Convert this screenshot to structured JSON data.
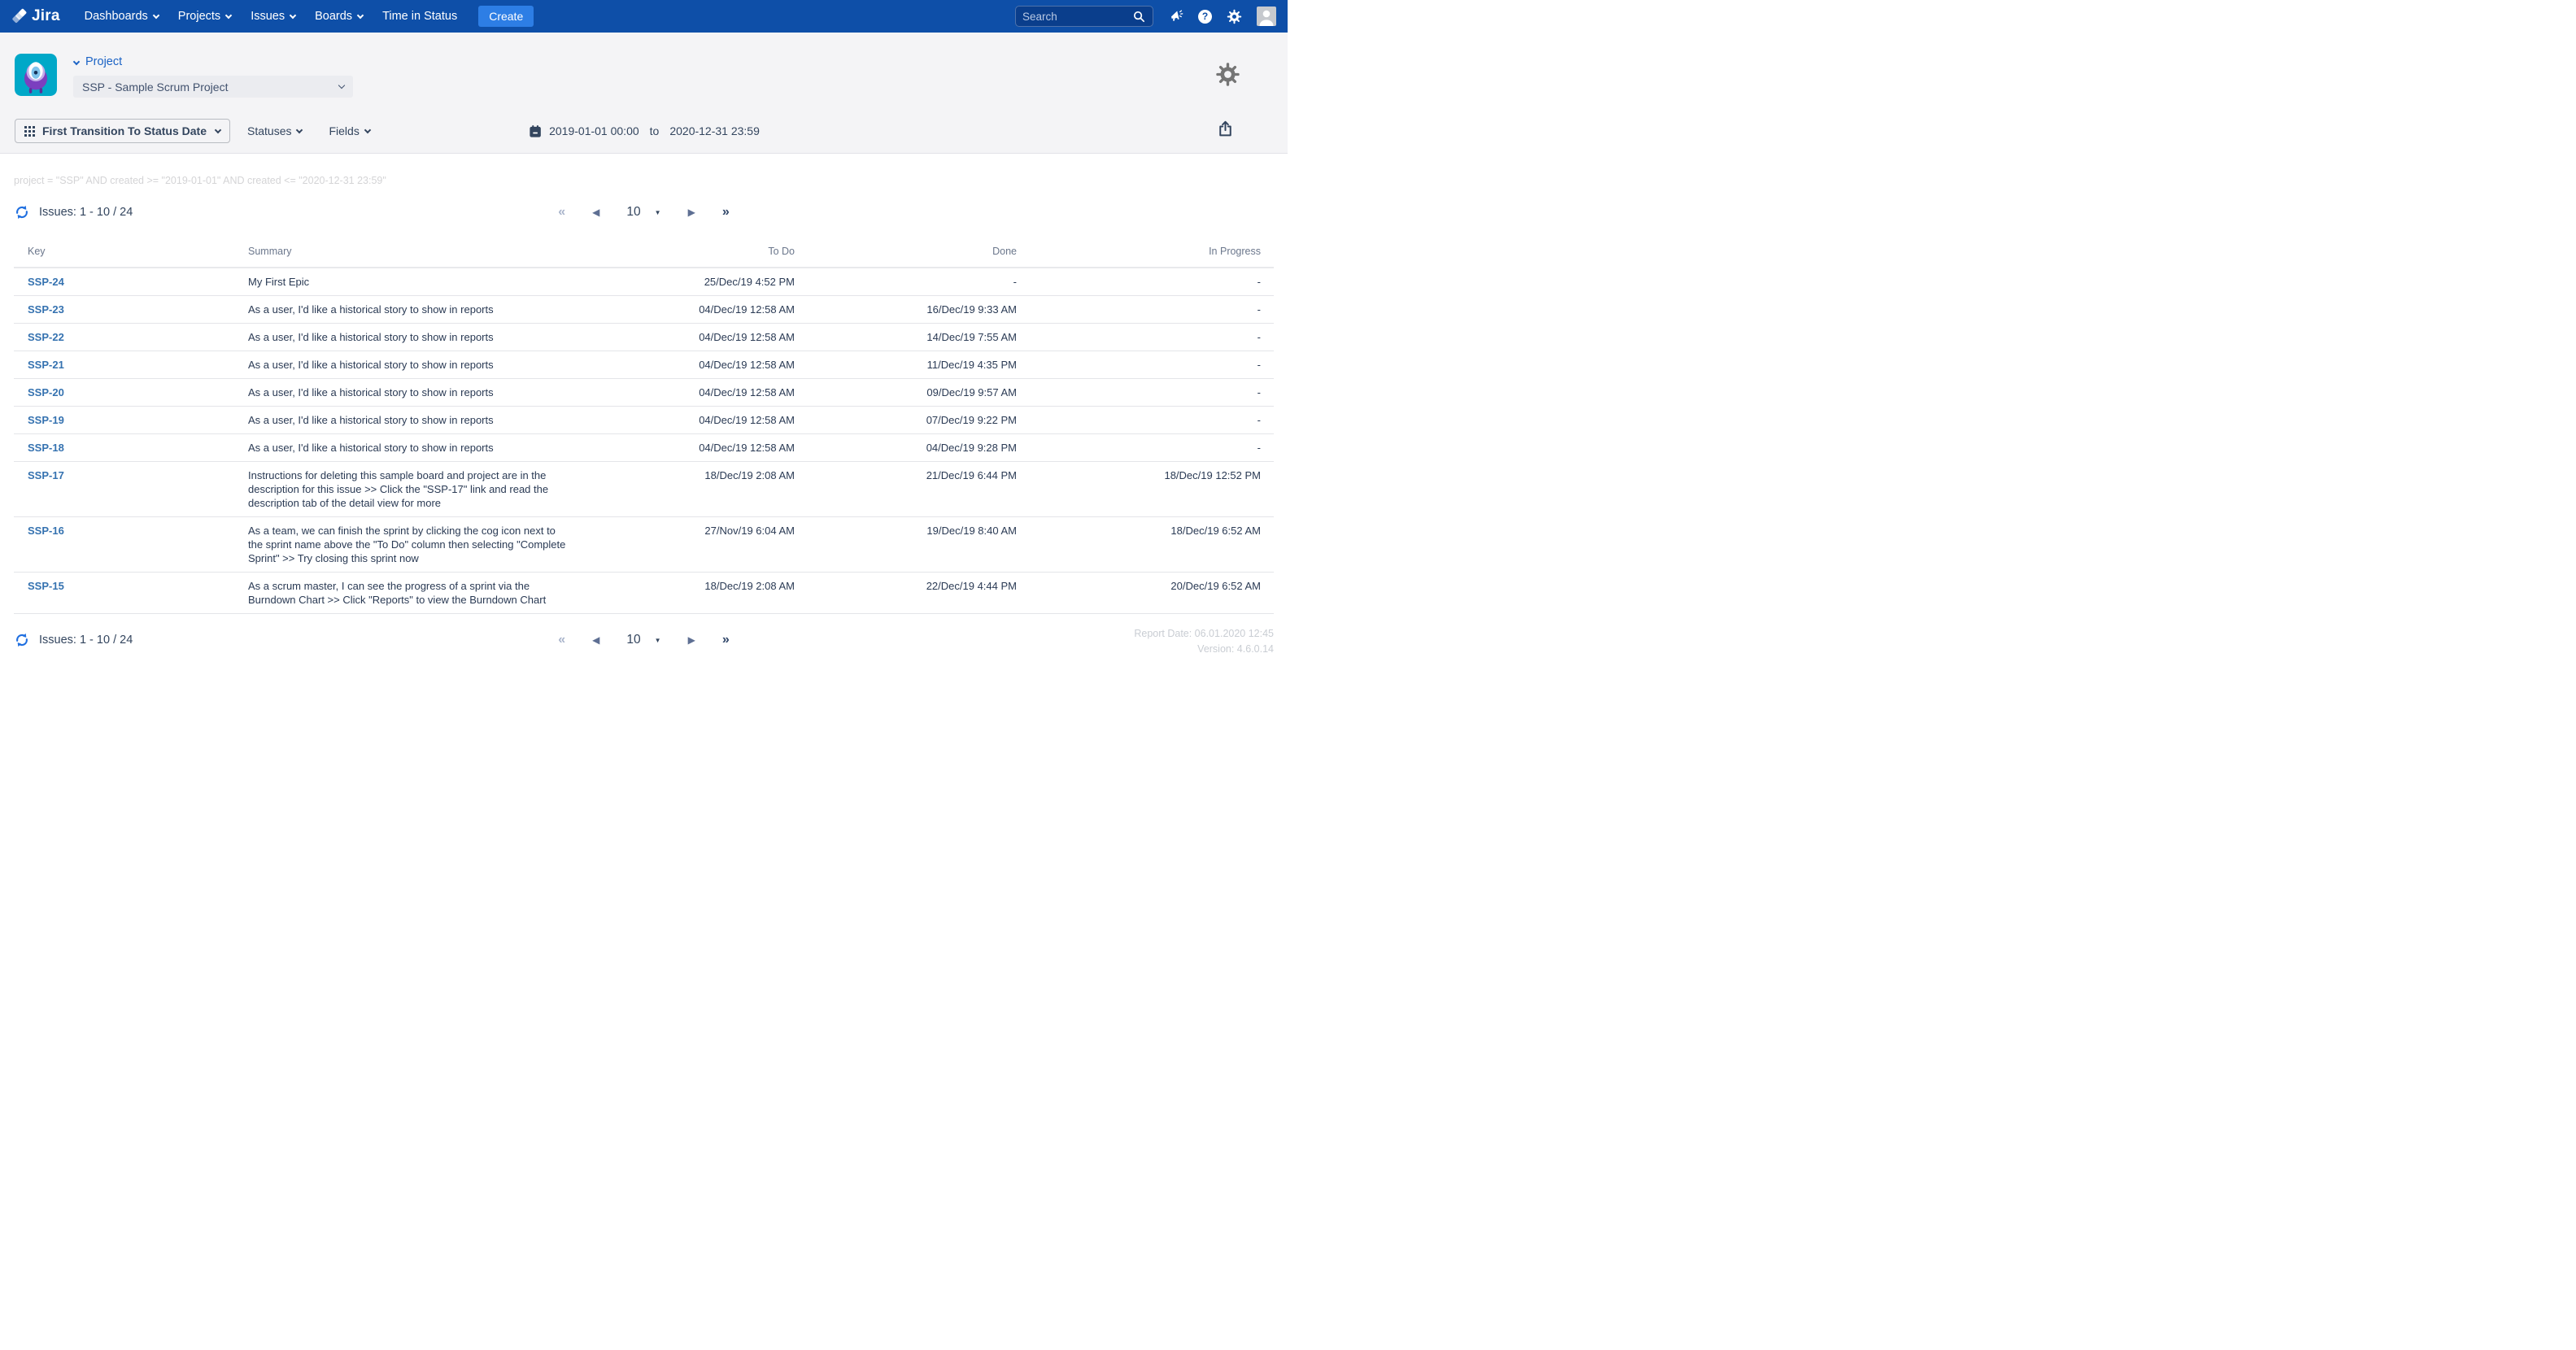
{
  "nav": {
    "brand": "Jira",
    "items": [
      {
        "label": "Dashboards"
      },
      {
        "label": "Projects"
      },
      {
        "label": "Issues"
      },
      {
        "label": "Boards"
      },
      {
        "label": "Time in Status"
      }
    ],
    "create_label": "Create",
    "search_placeholder": "Search"
  },
  "header": {
    "project_label": "Project",
    "project_select_value": "SSP - Sample Scrum Project"
  },
  "filters": {
    "report_type": "First Transition To Status Date",
    "statuses_label": "Statuses",
    "fields_label": "Fields",
    "date_from": "2019-01-01 00:00",
    "date_separator": "to",
    "date_to": "2020-12-31 23:59"
  },
  "jql": "project = \"SSP\" AND created >= \"2019-01-01\" AND created <= \"2020-12-31 23:59\"",
  "issues_count": "Issues: 1 - 10 / 24",
  "pagination": {
    "first_icon": "«",
    "prev_icon": "◀",
    "page_size": "10",
    "caret_icon": "▼",
    "next_icon": "▶",
    "last_icon": "»"
  },
  "table": {
    "columns": [
      "Key",
      "Summary",
      "To Do",
      "Done",
      "In Progress"
    ],
    "rows": [
      {
        "key": "SSP-24",
        "summary": "My First Epic",
        "todo": "25/Dec/19 4:52 PM",
        "done": "-",
        "in_progress": "-"
      },
      {
        "key": "SSP-23",
        "summary": "As a user, I'd like a historical story to show in reports",
        "todo": "04/Dec/19 12:58 AM",
        "done": "16/Dec/19 9:33 AM",
        "in_progress": "-"
      },
      {
        "key": "SSP-22",
        "summary": "As a user, I'd like a historical story to show in reports",
        "todo": "04/Dec/19 12:58 AM",
        "done": "14/Dec/19 7:55 AM",
        "in_progress": "-"
      },
      {
        "key": "SSP-21",
        "summary": "As a user, I'd like a historical story to show in reports",
        "todo": "04/Dec/19 12:58 AM",
        "done": "11/Dec/19 4:35 PM",
        "in_progress": "-"
      },
      {
        "key": "SSP-20",
        "summary": "As a user, I'd like a historical story to show in reports",
        "todo": "04/Dec/19 12:58 AM",
        "done": "09/Dec/19 9:57 AM",
        "in_progress": "-"
      },
      {
        "key": "SSP-19",
        "summary": "As a user, I'd like a historical story to show in reports",
        "todo": "04/Dec/19 12:58 AM",
        "done": "07/Dec/19 9:22 PM",
        "in_progress": "-"
      },
      {
        "key": "SSP-18",
        "summary": "As a user, I'd like a historical story to show in reports",
        "todo": "04/Dec/19 12:58 AM",
        "done": "04/Dec/19 9:28 PM",
        "in_progress": "-"
      },
      {
        "key": "SSP-17",
        "summary": "Instructions for deleting this sample board and project are in the description for this issue >> Click the \"SSP-17\" link and read the description tab of the detail view for more",
        "todo": "18/Dec/19 2:08 AM",
        "done": "21/Dec/19 6:44 PM",
        "in_progress": "18/Dec/19 12:52 PM"
      },
      {
        "key": "SSP-16",
        "summary": "As a team, we can finish the sprint by clicking the cog icon next to the sprint name above the \"To Do\" column then selecting \"Complete Sprint\" >> Try closing this sprint now",
        "todo": "27/Nov/19 6:04 AM",
        "done": "19/Dec/19 8:40 AM",
        "in_progress": "18/Dec/19 6:52 AM"
      },
      {
        "key": "SSP-15",
        "summary": "As a scrum master, I can see the progress of a sprint via the Burndown Chart >> Click \"Reports\" to view the Burndown Chart",
        "todo": "18/Dec/19 2:08 AM",
        "done": "22/Dec/19 4:44 PM",
        "in_progress": "20/Dec/19 6:52 AM"
      }
    ]
  },
  "footer": {
    "report_date": "Report Date: 06.01.2020 12:45",
    "version": "Version: 4.6.0.14"
  },
  "colors": {
    "nav_blue": "#0E4FA8",
    "create_blue": "#2D7EE5",
    "link_blue": "#1B63C5",
    "key_blue": "#3572B0",
    "header_bg": "#F4F4F6"
  }
}
